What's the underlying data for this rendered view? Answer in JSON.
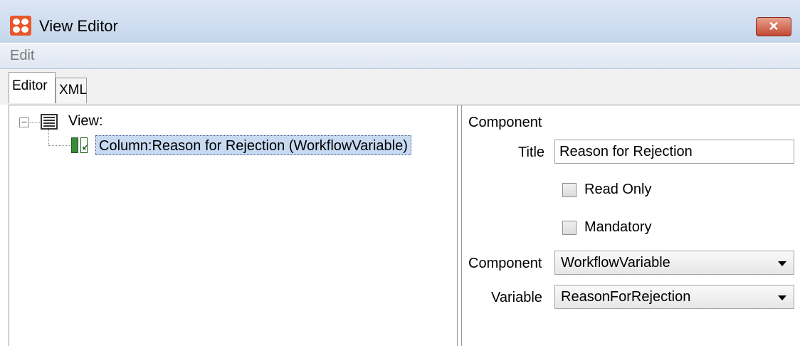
{
  "window": {
    "title": "View Editor",
    "close_label": "✕"
  },
  "menu": {
    "items": [
      "Edit"
    ]
  },
  "tabs": [
    {
      "label": "Editor"
    },
    {
      "label": "XML"
    }
  ],
  "tree": {
    "root": {
      "label": "View:",
      "toggle": "−"
    },
    "child": {
      "label": "Column:Reason for Rejection (WorkflowVariable)"
    }
  },
  "properties": {
    "heading": "Component",
    "title": {
      "label": "Title",
      "value": "Reason for Rejection"
    },
    "read_only": {
      "label": "Read Only",
      "checked": false
    },
    "mandatory": {
      "label": "Mandatory",
      "checked": false
    },
    "component": {
      "label": "Component",
      "value": "WorkflowVariable"
    },
    "variable": {
      "label": "Variable",
      "value": "ReasonForRejection"
    }
  }
}
